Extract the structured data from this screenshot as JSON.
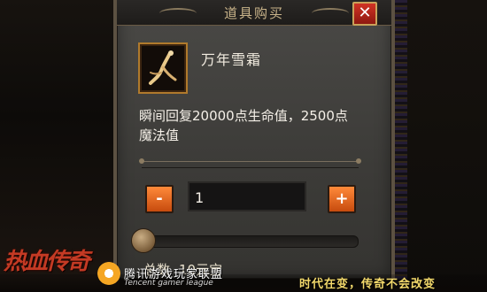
{
  "dialog": {
    "title": "道具购买",
    "close_label": "✕"
  },
  "item": {
    "name": "万年雪霜",
    "description": "瞬间回复20000点生命值，2500点魔法值",
    "icon": "ginseng-root-icon"
  },
  "quantity": {
    "minus_label": "-",
    "plus_label": "+",
    "value": "1",
    "slider_fraction": 0.0
  },
  "total": {
    "label": "总数",
    "value": "10元宝"
  },
  "branding": {
    "game_logo": "热血传奇",
    "publisher_cn": "腾讯游戏玩家联盟",
    "publisher_en": "Tencent gamer league",
    "slogan": "时代在变，传奇不会改变"
  },
  "colors": {
    "accent_orange": "#e0661e",
    "close_red": "#c0281b",
    "title_gold": "#c9b48a",
    "slogan_yellow": "#f3d96b"
  }
}
